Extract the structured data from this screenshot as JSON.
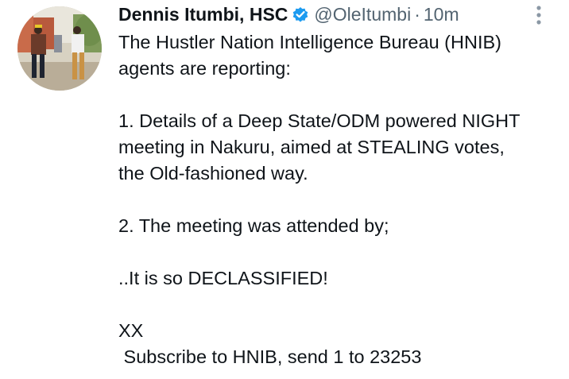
{
  "tweet": {
    "author": {
      "display_name": "Dennis Itumbi, HSC",
      "handle": "@OleItumbi",
      "verified": true,
      "avatar_icon": "profile-photo"
    },
    "separator": "·",
    "timestamp": "10m",
    "more_icon": "vertical-ellipsis-icon",
    "text_lines": [
      "The Hustler Nation Intelligence Bureau (HNIB)",
      "agents are reporting:",
      "",
      "1. Details of a Deep State/ODM powered NIGHT",
      "meeting in Nakuru, aimed at STEALING votes,",
      "the Old-fashioned way.",
      "",
      "2. The meeting was attended by;",
      "",
      "..It is so DECLASSIFIED!",
      "",
      "XX",
      " Subscribe to HNIB, send 1 to 23253"
    ]
  },
  "colors": {
    "text": "#0f1419",
    "secondary": "#536471",
    "verified": "#1d9bf0"
  }
}
